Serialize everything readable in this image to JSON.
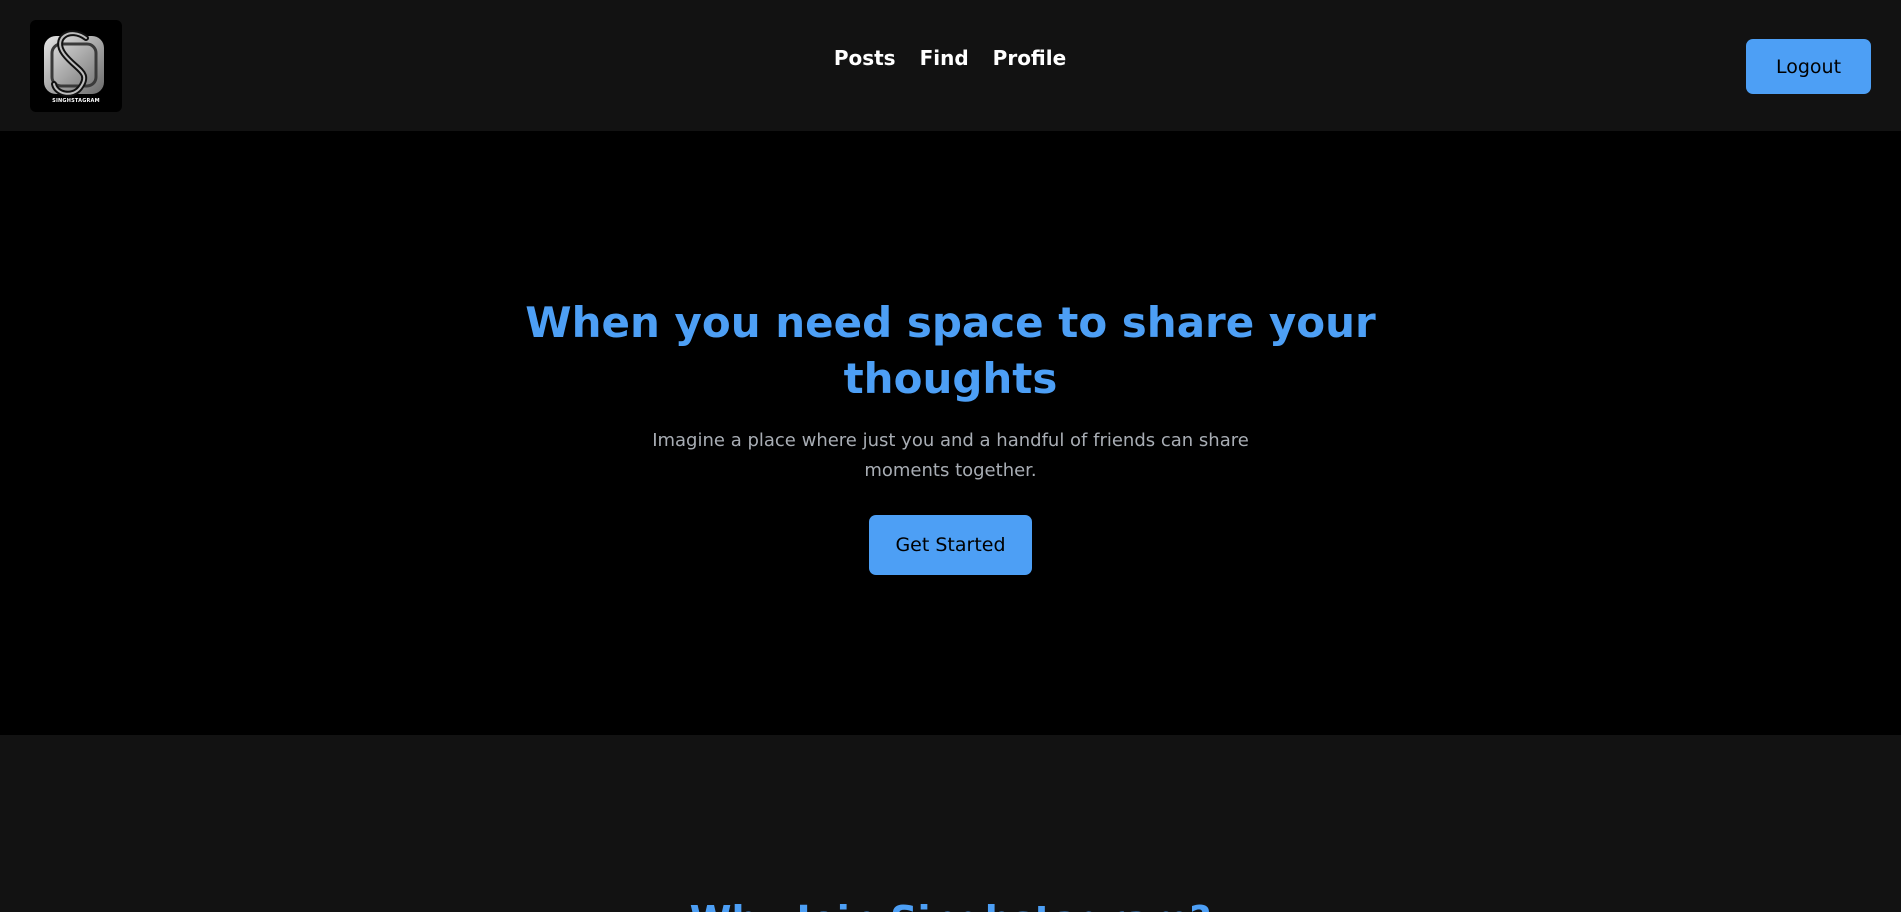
{
  "brand": {
    "logo_text": "SINGHSTAGRAM"
  },
  "nav": {
    "links": [
      {
        "label": "Posts"
      },
      {
        "label": "Find"
      },
      {
        "label": "Profile"
      }
    ],
    "logout_label": "Logout"
  },
  "hero": {
    "title": "When you need space to share your thoughts",
    "subtitle": "Imagine a place where just you and a handful of friends can share moments together.",
    "cta_label": "Get Started"
  },
  "why": {
    "title": "Why Join Singhstagram?"
  },
  "colors": {
    "accent": "#4d9ff5",
    "navbar_bg": "#121212",
    "hero_bg": "#000000",
    "subtitle_text": "#a8adb4"
  }
}
